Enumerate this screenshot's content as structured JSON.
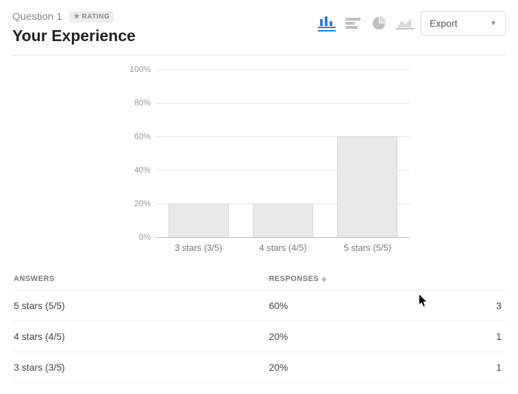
{
  "header": {
    "question_number": "Question 1",
    "badge_label": "RATING",
    "title": "Your Experience",
    "export_label": "Export"
  },
  "chart_types": {
    "bar": "bar-chart-icon",
    "hbar": "horizontal-bar-icon",
    "pie": "pie-chart-icon",
    "area": "area-chart-icon"
  },
  "chart_data": {
    "type": "bar",
    "title": "Your Experience",
    "xlabel": "",
    "ylabel": "",
    "ylim": [
      0,
      100
    ],
    "y_ticks": [
      "0%",
      "20%",
      "40%",
      "60%",
      "80%",
      "100%"
    ],
    "categories": [
      "3 stars (3/5)",
      "4 stars (4/5)",
      "5 stars (5/5)"
    ],
    "values": [
      20,
      20,
      60
    ],
    "value_unit": "%"
  },
  "table": {
    "headers": {
      "answers": "ANSWERS",
      "responses": "RESPONSES"
    },
    "rows": [
      {
        "answer": "5 stars (5/5)",
        "pct": "60%",
        "count": "3"
      },
      {
        "answer": "4 stars (4/5)",
        "pct": "20%",
        "count": "1"
      },
      {
        "answer": "3 stars (3/5)",
        "pct": "20%",
        "count": "1"
      }
    ]
  }
}
